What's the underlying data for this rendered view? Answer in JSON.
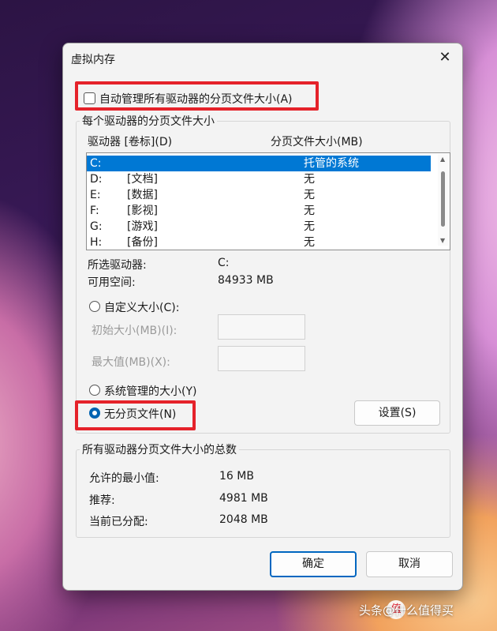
{
  "dialog": {
    "title": "虚拟内存",
    "close_glyph": "✕",
    "auto_manage_label": "自动管理所有驱动器的分页文件大小(A)",
    "auto_manage_checked": false
  },
  "per_drive": {
    "group_label": "每个驱动器的分页文件大小",
    "col_drive": "驱动器 [卷标](D)",
    "col_size": "分页文件大小(MB)",
    "drives": [
      {
        "drive": "C:",
        "label": "",
        "size": "托管的系统",
        "selected": true
      },
      {
        "drive": "D:",
        "label": "[文档]",
        "size": "无"
      },
      {
        "drive": "E:",
        "label": "[数据]",
        "size": "无"
      },
      {
        "drive": "F:",
        "label": "[影视]",
        "size": "无"
      },
      {
        "drive": "G:",
        "label": "[游戏]",
        "size": "无"
      },
      {
        "drive": "H:",
        "label": "[备份]",
        "size": "无"
      }
    ],
    "selected_drive_label": "所选驱动器:",
    "selected_drive_value": "C:",
    "free_space_label": "可用空间:",
    "free_space_value": "84933 MB",
    "custom_size_label": "自定义大小(C):",
    "initial_size_label": "初始大小(MB)(I):",
    "max_size_label": "最大值(MB)(X):",
    "system_managed_label": "系统管理的大小(Y)",
    "no_paging_label": "无分页文件(N)",
    "selected_option": "no_paging",
    "set_button": "设置(S)"
  },
  "totals": {
    "group_label": "所有驱动器分页文件大小的总数",
    "min_label": "允许的最小值:",
    "min_value": "16 MB",
    "recommended_label": "推荐:",
    "recommended_value": "4981 MB",
    "allocated_label": "当前已分配:",
    "allocated_value": "2048 MB"
  },
  "buttons": {
    "ok": "确定",
    "cancel": "取消"
  },
  "watermark": {
    "icon_text": "值",
    "text": "头条@什么值得买"
  },
  "colors": {
    "highlight_red": "#e5222a",
    "selection_blue": "#0078d4",
    "accent": "#0067c0"
  }
}
